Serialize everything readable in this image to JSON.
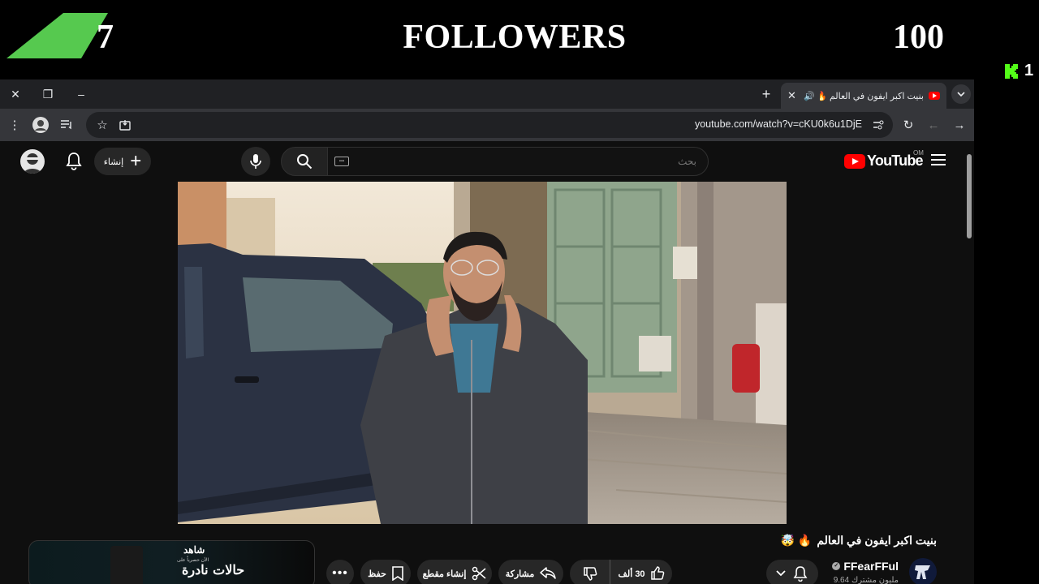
{
  "overlay": {
    "goal_current": "7",
    "goal_title": "FOLLOWERS",
    "goal_target": "100",
    "kick_count": "1",
    "accent_color": "#53fc18"
  },
  "browser": {
    "tab": {
      "title": "بنيت اكبر ايفون في العالم 🔥 🤯",
      "close": "✕",
      "audio_icon": "speaker-icon"
    },
    "new_tab": "+",
    "window": {
      "close": "✕",
      "restore": "❐",
      "minimize": "–"
    },
    "url": "youtube.com/watch?v=cKU0k6u1DjE"
  },
  "youtube": {
    "search_placeholder": "بحث",
    "create_label": "إنشاء",
    "logo_text": "YouTube",
    "region": "OM",
    "video": {
      "title": "بنيت اكبر ايفون في العالم",
      "title_emojis": "🔥 🤯",
      "channel": "FFearFFul",
      "subscribers": "9.64 مليون مشترك",
      "likes": "30 ألف",
      "share_label": "مشاركة",
      "clip_label": "إنشاء مقطع",
      "save_label": "حفظ"
    },
    "ad": {
      "brand": "شاهد",
      "subtitle": "الآن حصرياً على",
      "title": "حالات نادرة"
    }
  }
}
